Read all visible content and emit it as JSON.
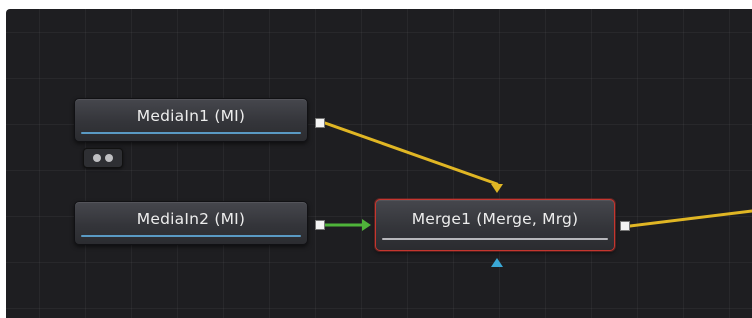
{
  "nodes": {
    "mediain1": {
      "label": "MediaIn1  (MI)"
    },
    "mediain2": {
      "label": "MediaIn2  (MI)"
    },
    "merge1": {
      "label": "Merge1  (Merge, Mrg)"
    }
  },
  "icons": {
    "output_port": "square",
    "background_input": "triangle-down",
    "foreground_input": "triangle-right",
    "mask_input": "triangle-up",
    "indicator_badge": "two-dots"
  },
  "colors": {
    "canvas": "#1e1e21",
    "background_wire": "#e0b624",
    "foreground_wire": "#4fb43a",
    "mask_input": "#3aa8d6",
    "selection": "#c5362f",
    "media_bar": "#5a9ac4"
  }
}
